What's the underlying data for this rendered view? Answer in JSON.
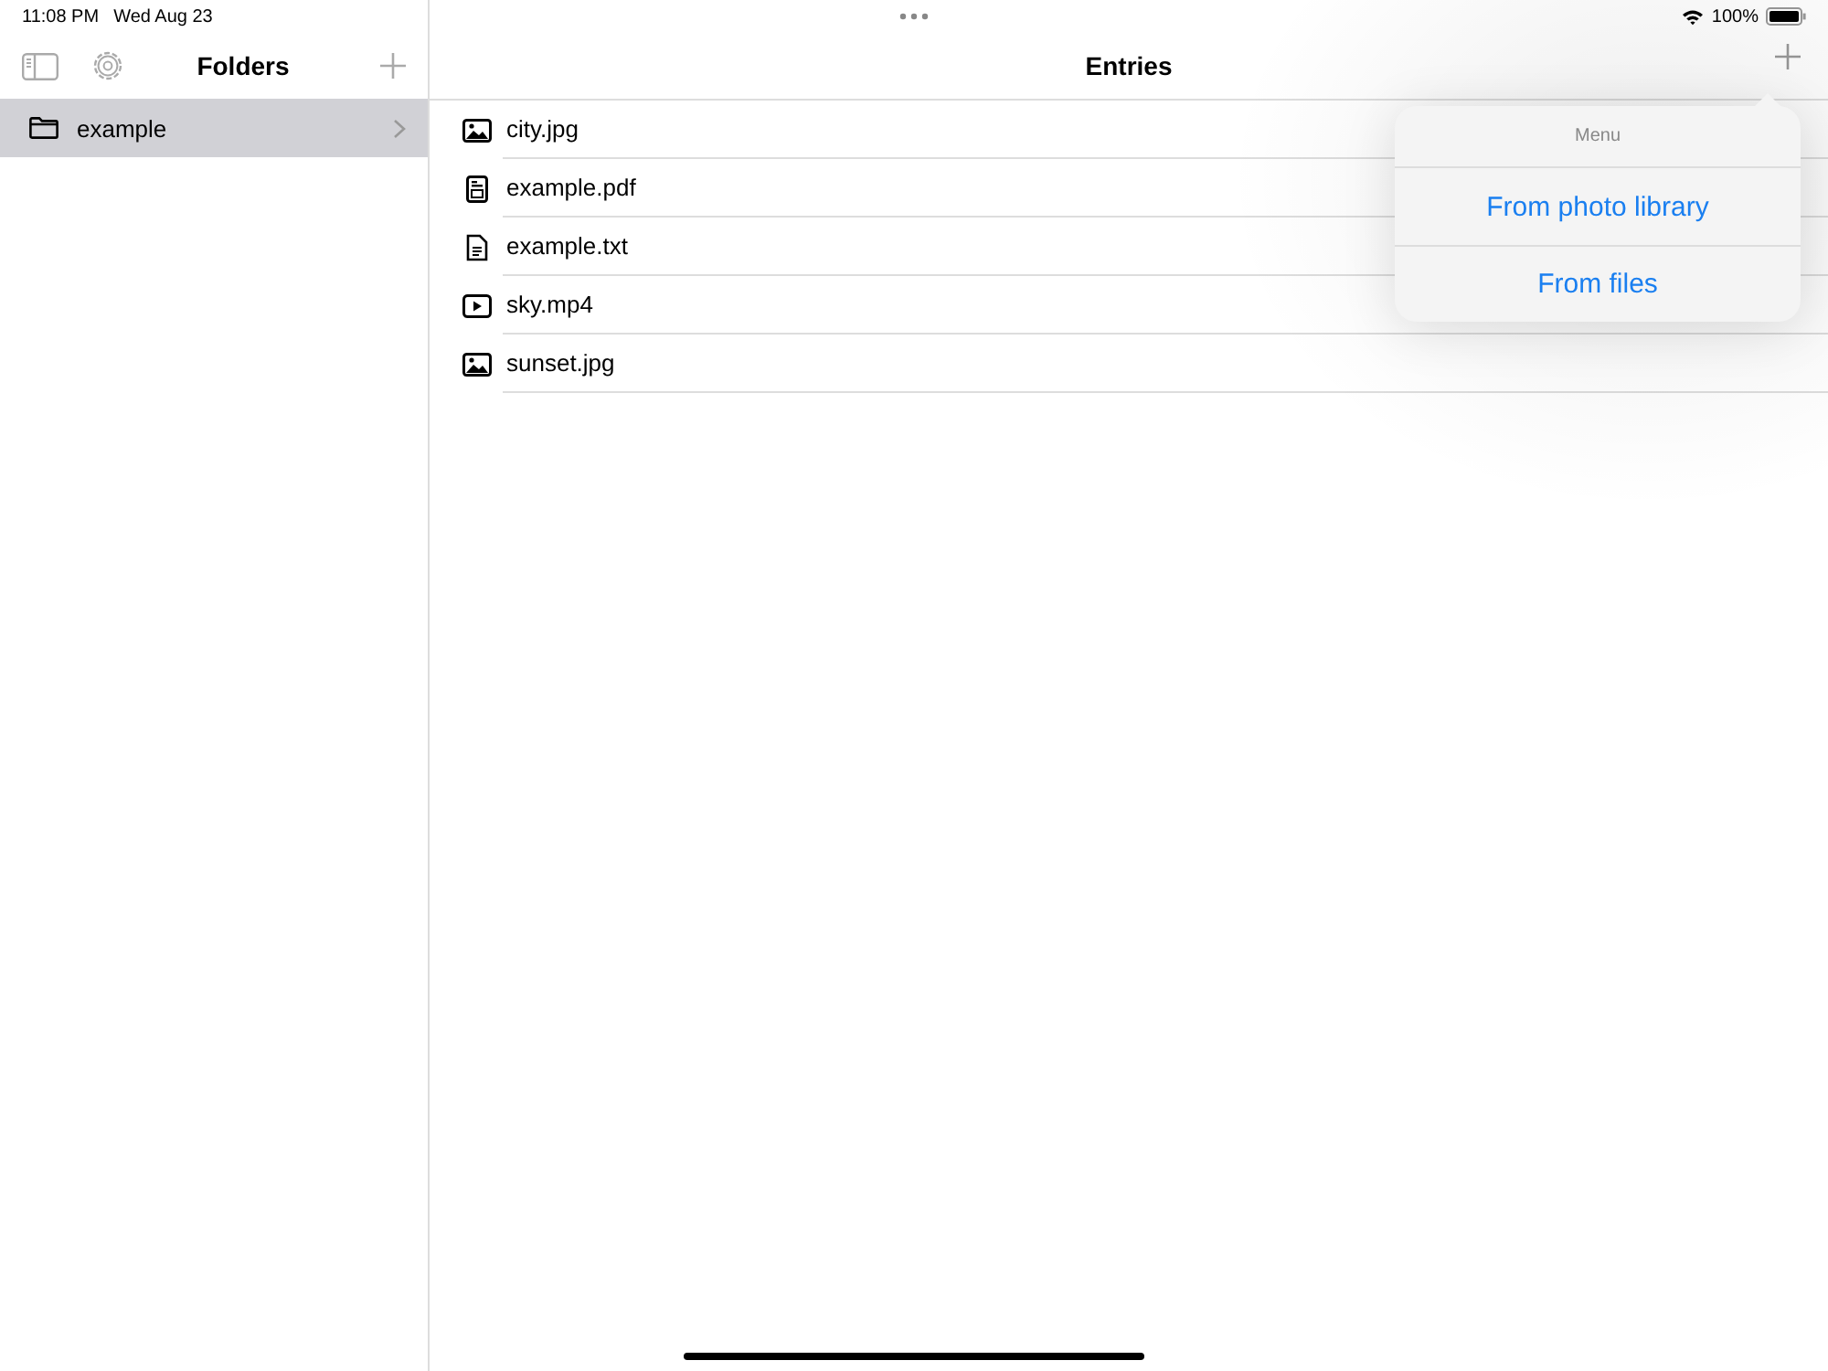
{
  "status_bar": {
    "time": "11:08 PM",
    "date": "Wed Aug 23",
    "battery": "100%"
  },
  "sidebar": {
    "title": "Folders",
    "items": [
      {
        "label": "example",
        "selected": true
      }
    ]
  },
  "entries": {
    "title": "Entries",
    "items": [
      {
        "name": "city.jpg",
        "kind": "image"
      },
      {
        "name": "example.pdf",
        "kind": "pdf"
      },
      {
        "name": "example.txt",
        "kind": "text"
      },
      {
        "name": "sky.mp4",
        "kind": "video"
      },
      {
        "name": "sunset.jpg",
        "kind": "image"
      }
    ]
  },
  "menu": {
    "title": "Menu",
    "items": [
      "From photo library",
      "From files"
    ]
  }
}
